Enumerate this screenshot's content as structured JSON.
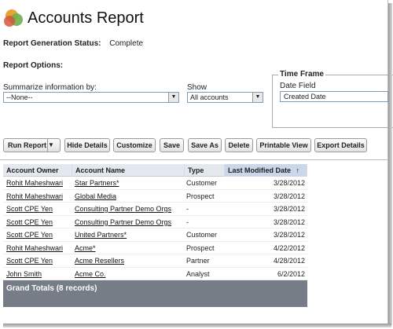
{
  "header": {
    "title": "Accounts Report",
    "logo_icon": "report-logo-icon"
  },
  "status": {
    "label": "Report Generation Status:",
    "value": "Complete"
  },
  "options": {
    "label": "Report Options:",
    "summarize_label": "Summarize information by:",
    "summarize_value": "--None--",
    "show_label": "Show",
    "show_value": "All accounts",
    "timeframe_legend": "Time Frame",
    "date_field_label": "Date Field",
    "date_field_value": "Created Date"
  },
  "toolbar": {
    "run_report": "Run Report",
    "hide_details": "Hide Details",
    "customize": "Customize",
    "save": "Save",
    "save_as": "Save As",
    "delete": "Delete",
    "printable_view": "Printable View",
    "export_details": "Export Details"
  },
  "table": {
    "columns": [
      "Account Owner",
      "Account Name",
      "Type",
      "Last Modified Date"
    ],
    "sort_indicator": "↑",
    "rows": [
      {
        "owner": "Rohit Maheshwari",
        "name": "Star Partners*",
        "type": "Customer",
        "date": "3/28/2012"
      },
      {
        "owner": "Rohit Maheshwari",
        "name": "Global Media",
        "type": "Prospect",
        "date": "3/28/2012"
      },
      {
        "owner": "Scott CPE Yen",
        "name": "Consulting Partner Demo Orgs",
        "type": "-",
        "date": "3/28/2012"
      },
      {
        "owner": "Scott CPE Yen",
        "name": "Consulting Partner Demo Orgs",
        "type": "-",
        "date": "3/28/2012"
      },
      {
        "owner": "Scott CPE Yen",
        "name": "United Partners*",
        "type": "Customer",
        "date": "3/28/2012"
      },
      {
        "owner": "Rohit Maheshwari",
        "name": "Acme*",
        "type": "Prospect",
        "date": "4/22/2012"
      },
      {
        "owner": "Scott CPE Yen",
        "name": "Acme Resellers",
        "type": "Partner",
        "date": "4/28/2012"
      },
      {
        "owner": "John Smith",
        "name": "Acme Co.",
        "type": "Analyst",
        "date": "6/2/2012"
      }
    ],
    "grand_totals": "Grand Totals (8 records)"
  },
  "colors": {
    "header_bg": "#e3e8ef",
    "sorted_col": "#c9d7e8",
    "grand_totals_bg": "#777d86"
  }
}
